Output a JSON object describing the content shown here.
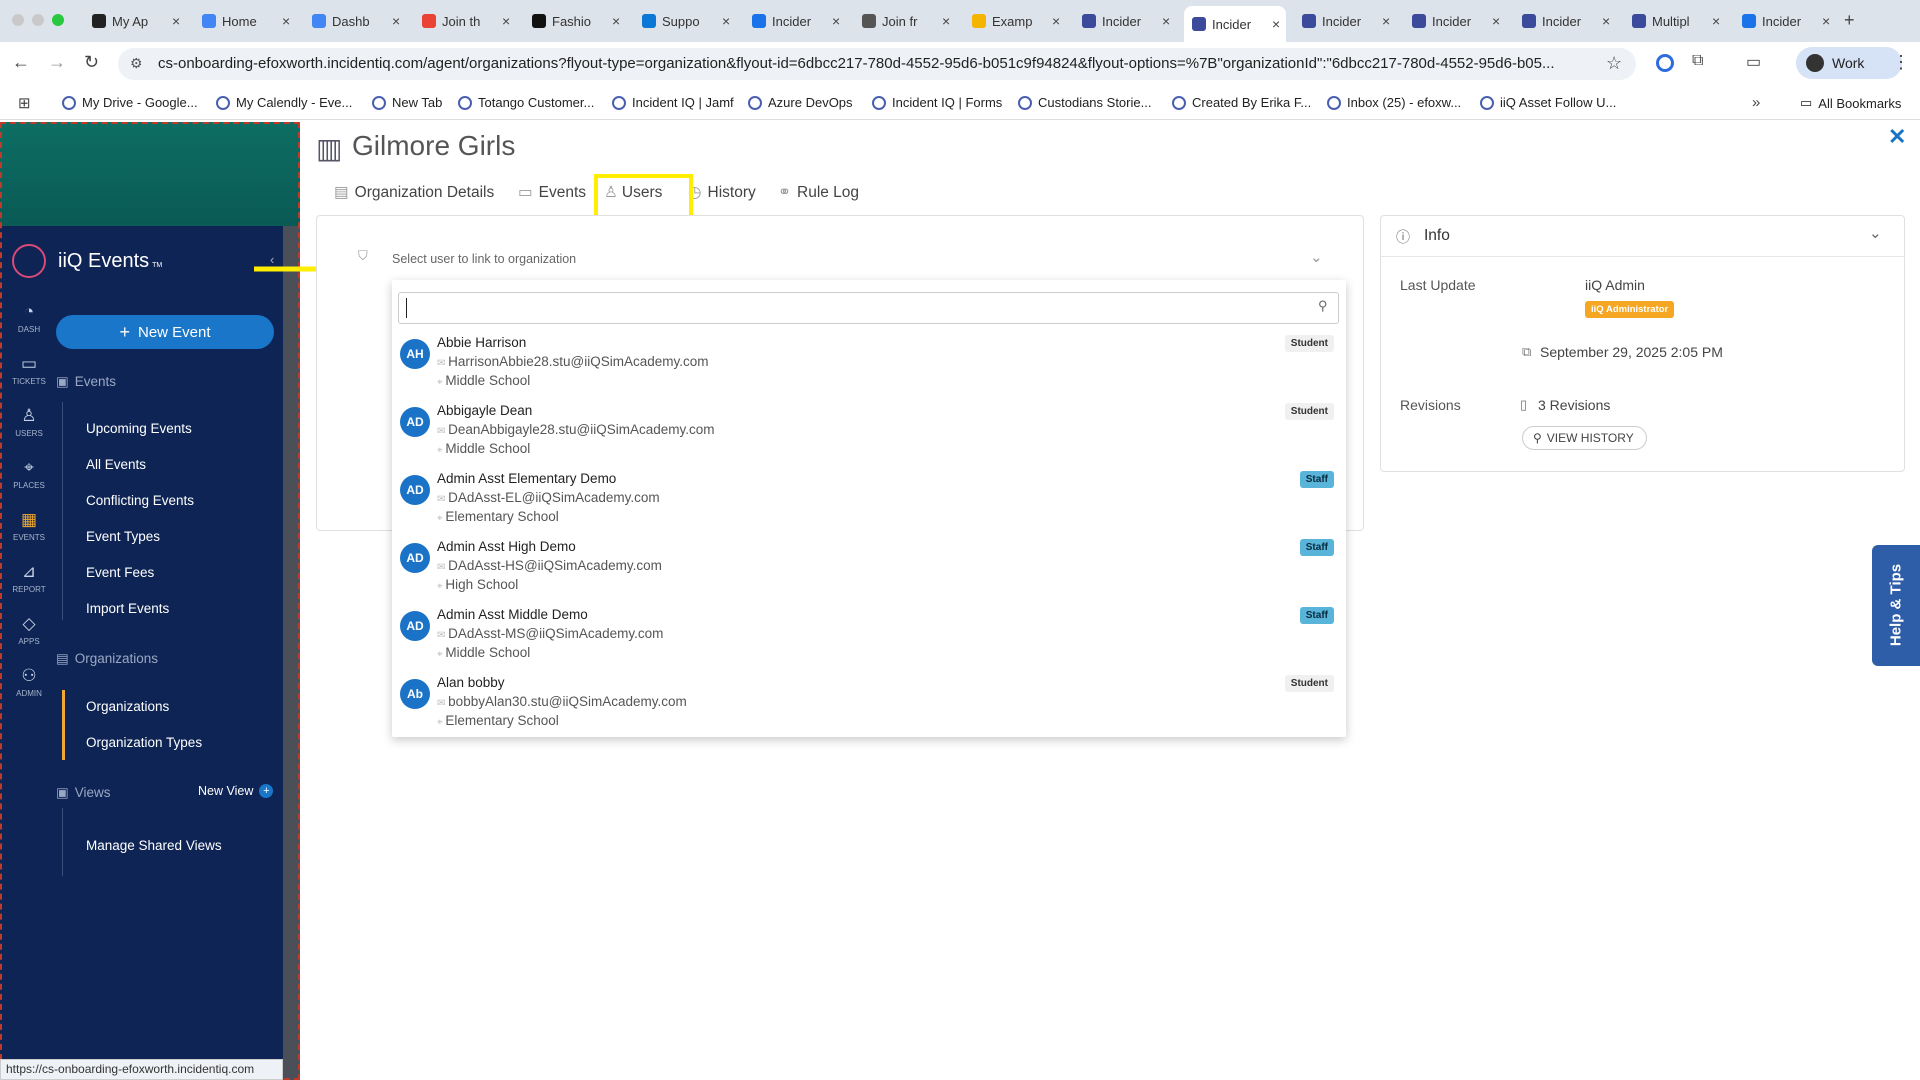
{
  "browser": {
    "tabs": [
      {
        "label": "My Ap",
        "icon": "circle-icon"
      },
      {
        "label": "Home",
        "icon": "google-icon"
      },
      {
        "label": "Dashb",
        "icon": "google-icon"
      },
      {
        "label": "Join th",
        "icon": "gmail-icon"
      },
      {
        "label": "Fashio",
        "icon": "page-icon"
      },
      {
        "label": "Suppo",
        "icon": "azure-icon"
      },
      {
        "label": "Incider",
        "icon": "calendar-icon"
      },
      {
        "label": "Join fr",
        "icon": "globe-icon"
      },
      {
        "label": "Examp",
        "icon": "slides-icon"
      },
      {
        "label": "Incider",
        "icon": "incidentiq-icon"
      },
      {
        "label": "Incider",
        "icon": "incidentiq-icon",
        "active": true
      },
      {
        "label": "Incider",
        "icon": "incidentiq-icon"
      },
      {
        "label": "Incider",
        "icon": "incidentiq-icon"
      },
      {
        "label": "Incider",
        "icon": "incidentiq-icon"
      },
      {
        "label": "Multipl",
        "icon": "incidentiq-icon"
      },
      {
        "label": "Incider",
        "icon": "calendar-icon"
      }
    ],
    "url": "cs-onboarding-efoxworth.incidentiq.com/agent/organizations?flyout-type=organization&flyout-id=6dbcc217-780d-4552-95d6-b051c9f94824&flyout-options=%7B\"organizationId\":\"6dbcc217-780d-4552-95d6-b05...",
    "profile": "Work",
    "bookmarks": [
      "My Drive - Google...",
      "My Calendly - Eve...",
      "New Tab",
      "Totango Customer...",
      "Incident IQ | Jamf",
      "Azure DevOps",
      "Incident IQ | Forms",
      "Custodians Storie...",
      "Created By Erika F...",
      "Inbox (25) - efoxw...",
      "iiQ Asset Follow U..."
    ],
    "all_bookmarks": "All Bookmarks",
    "status_url": "https://cs-onboarding-efoxworth.incidentiq.com"
  },
  "sidebar": {
    "logo": "iiQ Events",
    "logo_tm": "TM",
    "new_event": "New Event",
    "rail": [
      "DASH",
      "TICKETS",
      "USERS",
      "PLACES",
      "EVENTS",
      "REPORT",
      "APPS",
      "ADMIN"
    ],
    "events_section": "Events",
    "events_items": [
      "Upcoming Events",
      "All Events",
      "Conflicting Events",
      "Event Types",
      "Event Fees",
      "Import Events"
    ],
    "org_section": "Organizations",
    "org_items": [
      "Organizations",
      "Organization Types"
    ],
    "views_section": "Views",
    "new_view": "New View",
    "views_items": [
      "Manage Shared Views"
    ]
  },
  "flyout": {
    "title": "Gilmore Girls",
    "tabs": [
      "Organization Details",
      "Events",
      "Users",
      "History",
      "Rule Log"
    ],
    "select_placeholder": "Select user to link to organization",
    "users": [
      {
        "initials": "AH",
        "name": "Abbie Harrison",
        "email": "HarrisonAbbie28.stu@iiQSimAcademy.com",
        "location": "Middle School",
        "role": "Student"
      },
      {
        "initials": "AD",
        "name": "Abbigayle Dean",
        "email": "DeanAbbigayle28.stu@iiQSimAcademy.com",
        "location": "Middle School",
        "role": "Student"
      },
      {
        "initials": "AD",
        "name": "Admin Asst Elementary Demo",
        "email": "DAdAsst-EL@iiQSimAcademy.com",
        "location": "Elementary School",
        "role": "Staff"
      },
      {
        "initials": "AD",
        "name": "Admin Asst High Demo",
        "email": "DAdAsst-HS@iiQSimAcademy.com",
        "location": "High School",
        "role": "Staff"
      },
      {
        "initials": "AD",
        "name": "Admin Asst Middle Demo",
        "email": "DAdAsst-MS@iiQSimAcademy.com",
        "location": "Middle School",
        "role": "Staff"
      },
      {
        "initials": "Ab",
        "name": "Alan bobby",
        "email": "bobbyAlan30.stu@iiQSimAcademy.com",
        "location": "Elementary School",
        "role": "Student"
      }
    ],
    "info": {
      "title": "Info",
      "last_update_label": "Last Update",
      "last_update_user": "iiQ Admin",
      "last_update_badge": "iiQ Administrator",
      "last_update_date": "September 29, 2025 2:05 PM",
      "revisions_label": "Revisions",
      "revisions_value": "3 Revisions",
      "view_history": "VIEW HISTORY"
    },
    "help_tab": "Help & Tips"
  },
  "colors": {
    "sidebar": "#0e2454",
    "accent": "#1976c9",
    "highlight": "#ffee00",
    "arrow": "#ffee00",
    "badge_admin": "#f5a623"
  }
}
